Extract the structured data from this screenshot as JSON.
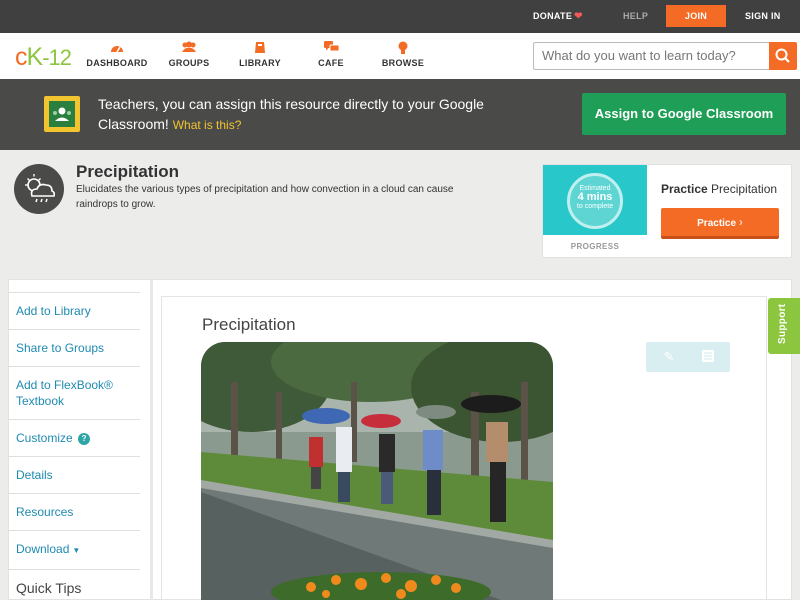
{
  "utility": {
    "donate": "DONATE",
    "help": "HELP",
    "join": "JOIN",
    "sign_in": "SIGN IN"
  },
  "logo": {
    "c": "c",
    "k": "K",
    "dash_num": "-12"
  },
  "nav": {
    "dashboard": "DASHBOARD",
    "groups": "GROUPS",
    "library": "LIBRARY",
    "cafe": "CAFE",
    "browse": "BROWSE"
  },
  "search": {
    "placeholder": "What do you want to learn today?"
  },
  "classroom_bar": {
    "message": "Teachers, you can assign this resource directly to your Google Classroom!",
    "what_link": "What is this?",
    "assign_button": "Assign to Google Classroom"
  },
  "resource": {
    "title": "Precipitation",
    "description": "Elucidates the various types of precipitation and how convection in a cloud can cause raindrops to grow."
  },
  "practice_card": {
    "estimated": "Estimated",
    "minutes": "4 mins",
    "to_complete": "to complete",
    "progress_label": "PROGRESS",
    "heading_bold": "Practice",
    "heading_rest": " Precipitation",
    "button": "Practice"
  },
  "sidebar": {
    "add_library": "Add to Library",
    "share_groups": "Share to Groups",
    "add_flexbook": "Add to FlexBook® Textbook",
    "customize": "Customize",
    "customize_badge": "?",
    "details": "Details",
    "resources": "Resources",
    "download": "Download",
    "quick_tips": "Quick Tips"
  },
  "content": {
    "title": "Precipitation"
  },
  "support": "Support",
  "icons": {
    "heart": "heart-icon",
    "search": "search-icon",
    "weather": "rain-cloud-icon",
    "pen": "pencil-icon",
    "note": "notes-icon"
  },
  "colors": {
    "accent": "#f36b24",
    "brand_green": "#8cc63e",
    "classroom_green": "#1e9e56",
    "link": "#1f8ab0",
    "teal": "#28c7c9"
  }
}
